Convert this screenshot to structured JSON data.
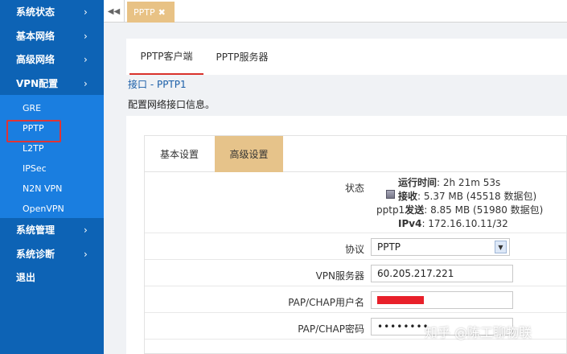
{
  "sidebar": {
    "items_top": [
      {
        "label": "系统状态",
        "chevron": "›"
      },
      {
        "label": "基本网络",
        "chevron": "›"
      },
      {
        "label": "高级网络",
        "chevron": "›"
      },
      {
        "label": "VPN配置",
        "chevron": "›"
      }
    ],
    "vpn_sub": [
      "GRE",
      "PPTP",
      "L2TP",
      "IPSec",
      "N2N VPN",
      "OpenVPN"
    ],
    "items_bottom": [
      {
        "label": "系统管理",
        "chevron": "›"
      },
      {
        "label": "系统诊断",
        "chevron": "›"
      },
      {
        "label": "退出",
        "chevron": ""
      }
    ],
    "active_sub": "PPTP"
  },
  "tabstrip": {
    "scroll_icon": "◀◀",
    "open_tab": "PPTP",
    "close_icon": "✖"
  },
  "content": {
    "tabs": {
      "client": "PPTP客户端",
      "server": "PPTP服务器"
    },
    "title": "接口 - PPTP1",
    "description": "配置网络接口信息。",
    "panel_tabs": {
      "basic": "基本设置",
      "advanced": "高级设置"
    },
    "status": {
      "label": "状态",
      "uptime_key": "运行时间",
      "uptime_value": ": 2h 21m 53s",
      "rx_key": "接收",
      "rx_value": ": 5.37 MB (45518 数据包)",
      "iface": "pptp1",
      "tx_key": "发送",
      "tx_value": ": 8.85 MB (51980 数据包)",
      "ipv4_key": "IPv4",
      "ipv4_value": ": 172.16.10.11/32"
    },
    "protocol": {
      "label": "协议",
      "value": "PPTP"
    },
    "vpn_server": {
      "label": "VPN服务器",
      "value": "60.205.217.221"
    },
    "username": {
      "label": "PAP/CHAP用户名"
    },
    "password": {
      "label": "PAP/CHAP密码",
      "value": "••••••••"
    }
  },
  "watermark": "知乎 @陈工聊物联",
  "colors": {
    "sidebar": "#0d63b5",
    "submenu": "#1a7ee0",
    "accent_tab": "#e6c38a",
    "highlight": "#e03434"
  }
}
